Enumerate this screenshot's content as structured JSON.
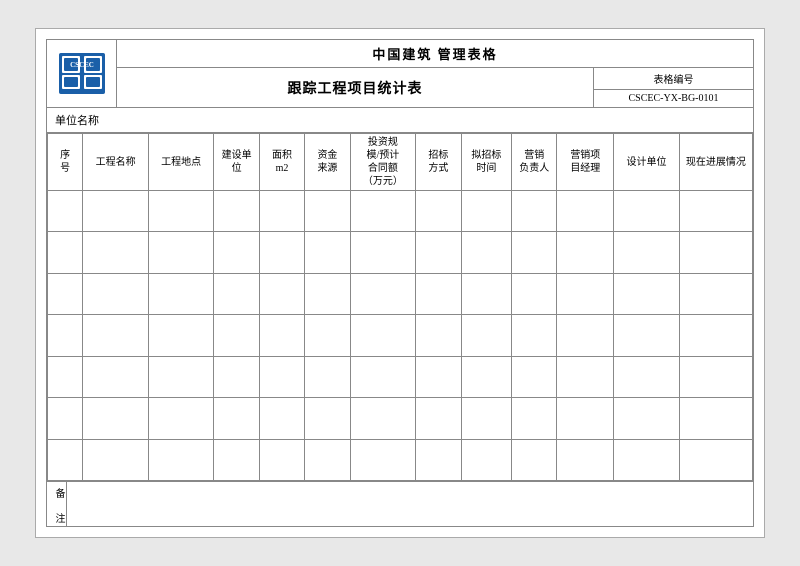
{
  "header": {
    "title": "中国建筑   管理表格",
    "subtitle": "跟踪工程项目统计表",
    "code_label": "表格编号",
    "code_value": "CSCEC-YX-BG-0101"
  },
  "unit_row": {
    "label": "单位名称"
  },
  "table": {
    "columns": [
      {
        "id": "seq",
        "label": "序\n号"
      },
      {
        "id": "name",
        "label": "工程名称"
      },
      {
        "id": "location",
        "label": "工程地点"
      },
      {
        "id": "build_unit",
        "label": "建设单\n位"
      },
      {
        "id": "area",
        "label": "面积\nm2"
      },
      {
        "id": "fund",
        "label": "资金\n来源"
      },
      {
        "id": "invest",
        "label": "投资规\n模/预计\n合同额\n（万元）"
      },
      {
        "id": "bid",
        "label": "招标\n方式"
      },
      {
        "id": "bid_time",
        "label": "拟招标\n时间"
      },
      {
        "id": "sales_resp",
        "label": "营销\n负责人"
      },
      {
        "id": "sales_mgr",
        "label": "营销项\n目经理"
      },
      {
        "id": "design",
        "label": "设计单位"
      },
      {
        "id": "progress",
        "label": "现在进展情况"
      }
    ],
    "data_rows": 7
  },
  "remarks": {
    "label": "备\n注"
  }
}
